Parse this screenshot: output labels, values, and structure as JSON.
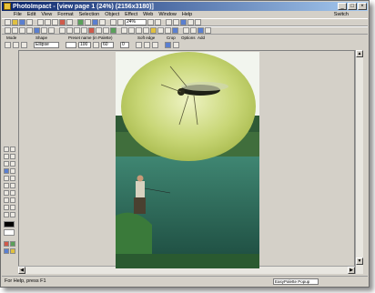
{
  "window": {
    "title": "PhotoImpact - [view page 1 (24%) (2156x3180)]",
    "caption_min": "_",
    "caption_max": "□",
    "caption_close": "×"
  },
  "menu": {
    "items": [
      "File",
      "Edit",
      "View",
      "Format",
      "Selection",
      "Object",
      "Effect",
      "Web",
      "Window",
      "Help"
    ],
    "switch_label": "Switch"
  },
  "toolbar": {
    "zoom_value": "24%",
    "style_value": ""
  },
  "options": {
    "labels": [
      "Mode",
      "Shape",
      "Preset name (in Palette)",
      "Soft edge",
      "Crop",
      "Options",
      "Add"
    ],
    "mode_value": "",
    "shape_value": "Ellipse",
    "preset_value": "",
    "size_w": "100",
    "size_h": "60",
    "soft_edge_value": "0"
  },
  "statusbar": {
    "help_text": "For Help, press F1",
    "combo_value": "EasyPalette Popup"
  },
  "canvas": {
    "image_desc_colors": {
      "ellipse_light": "#dfe8a0",
      "ellipse_mid": "#b9c95a",
      "sky": "#f2f5ee",
      "trees": "#2f5a36",
      "water": "#2a6a5c"
    }
  }
}
